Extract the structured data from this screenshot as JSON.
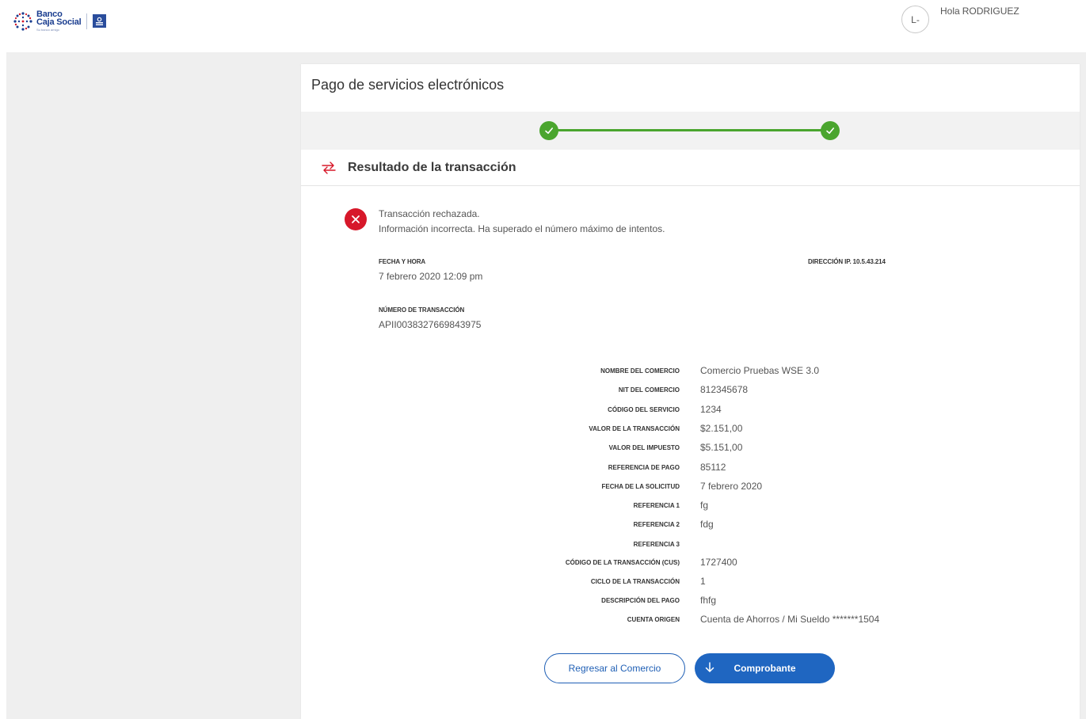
{
  "header": {
    "logo": {
      "line1": "Banco",
      "line2": "Caja Social",
      "tagline": "Su banco amigo"
    },
    "avatar_initials": "L-",
    "greeting_prefix": "Hola",
    "user_name": "RODRIGUEZ"
  },
  "page": {
    "title": "Pago de servicios electrónicos"
  },
  "stepper": {
    "steps_completed": 2,
    "steps_total": 2,
    "color": "#4aa52e"
  },
  "section": {
    "title": "Resultado de la transacción",
    "icon": "exchange-arrows-icon"
  },
  "result": {
    "status_icon": "error-x-icon",
    "status_color": "#d7182a",
    "message_line1": "Transacción rechazada.",
    "message_line2": "Información incorrecta. Ha superado el número máximo de intentos."
  },
  "summary": {
    "date_label": "FECHA Y HORA",
    "date_value": "7 febrero 2020 12:09 pm",
    "ip_label": "DIRECCIÓN IP. 10.5.43.214",
    "tx_label": "NÚMERO DE TRANSACCIÓN",
    "tx_value": "APII0038327669843975"
  },
  "details": [
    {
      "label": "NOMBRE DEL COMERCIO",
      "value": "Comercio Pruebas WSE 3.0"
    },
    {
      "label": "NIT DEL COMERCIO",
      "value": "812345678"
    },
    {
      "label": "CÓDIGO DEL SERVICIO",
      "value": "1234"
    },
    {
      "label": "VALOR DE LA TRANSACCIÓN",
      "value": "$2.151,00"
    },
    {
      "label": "VALOR DEL IMPUESTO",
      "value": "$5.151,00"
    },
    {
      "label": "REFERENCIA DE PAGO",
      "value": "85112"
    },
    {
      "label": "FECHA DE LA SOLICITUD",
      "value": "7 febrero 2020"
    },
    {
      "label": "REFERENCIA 1",
      "value": "fg"
    },
    {
      "label": "REFERENCIA 2",
      "value": "fdg"
    },
    {
      "label": "REFERENCIA 3",
      "value": ""
    },
    {
      "label": "CÓDIGO DE LA TRANSACCIÓN (CUS)",
      "value": "1727400"
    },
    {
      "label": "CICLO DE LA TRANSACCIÓN",
      "value": "1"
    },
    {
      "label": "DESCRIPCIÓN DEL PAGO",
      "value": "fhfg"
    },
    {
      "label": "CUENTA ORIGEN",
      "value": "Cuenta de Ahorros / Mi Sueldo *******1504"
    }
  ],
  "buttons": {
    "back_label": "Regresar al Comercio",
    "receipt_label": "Comprobante",
    "receipt_icon": "download-arrow-icon",
    "primary_color": "#1f66c1"
  }
}
